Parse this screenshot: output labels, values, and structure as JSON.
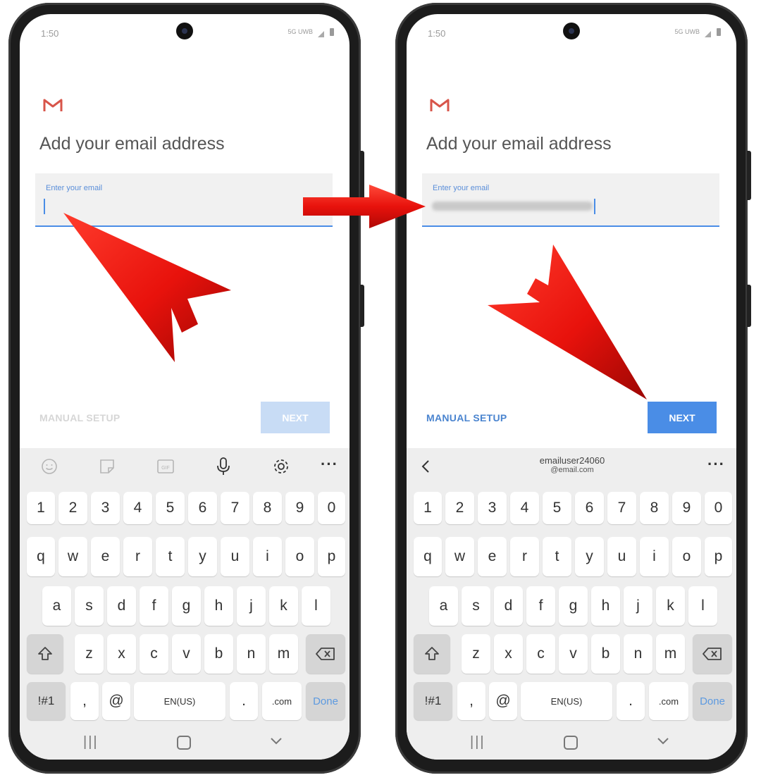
{
  "colors": {
    "accent_blue": "#4a8de6",
    "next_enabled": "#4a8de6",
    "next_disabled": "#c8dcf5",
    "manual_enabled": "#4a84cf",
    "manual_disabled": "#d6d6d6",
    "gmail_red": "#d8554a",
    "arrow_red": "#e8120c"
  },
  "left_phone": {
    "status": {
      "time": "1:50",
      "network": "5G UWB"
    },
    "title": "Add your email address",
    "email_label": "Enter your email",
    "manual_setup": "MANUAL SETUP",
    "next": "NEXT",
    "next_enabled": false,
    "toolbar_icons": [
      "emoji-icon",
      "sticker-icon",
      "gif-icon",
      "microphone-icon",
      "settings-icon",
      "more-icon"
    ]
  },
  "right_phone": {
    "status": {
      "time": "1:50",
      "network": "5G UWB"
    },
    "title": "Add your email address",
    "email_label": "Enter your email",
    "manual_setup": "MANUAL SETUP",
    "next": "NEXT",
    "next_enabled": true,
    "suggestion_line1": "emailuser24060",
    "suggestion_line2": "@email.com"
  },
  "keyboard": {
    "numbers": [
      "1",
      "2",
      "3",
      "4",
      "5",
      "6",
      "7",
      "8",
      "9",
      "0"
    ],
    "row1": [
      "q",
      "w",
      "e",
      "r",
      "t",
      "y",
      "u",
      "i",
      "o",
      "p"
    ],
    "row2": [
      "a",
      "s",
      "d",
      "f",
      "g",
      "h",
      "j",
      "k",
      "l"
    ],
    "row3": [
      "z",
      "x",
      "c",
      "v",
      "b",
      "n",
      "m"
    ],
    "symbols": "!#1",
    "comma": ",",
    "at": "@",
    "space": "EN(US)",
    "period": ".",
    "dotcom": ".com",
    "done": "Done",
    "more": "···"
  },
  "nav_icons": [
    "recents-icon",
    "home-icon",
    "back-icon"
  ]
}
